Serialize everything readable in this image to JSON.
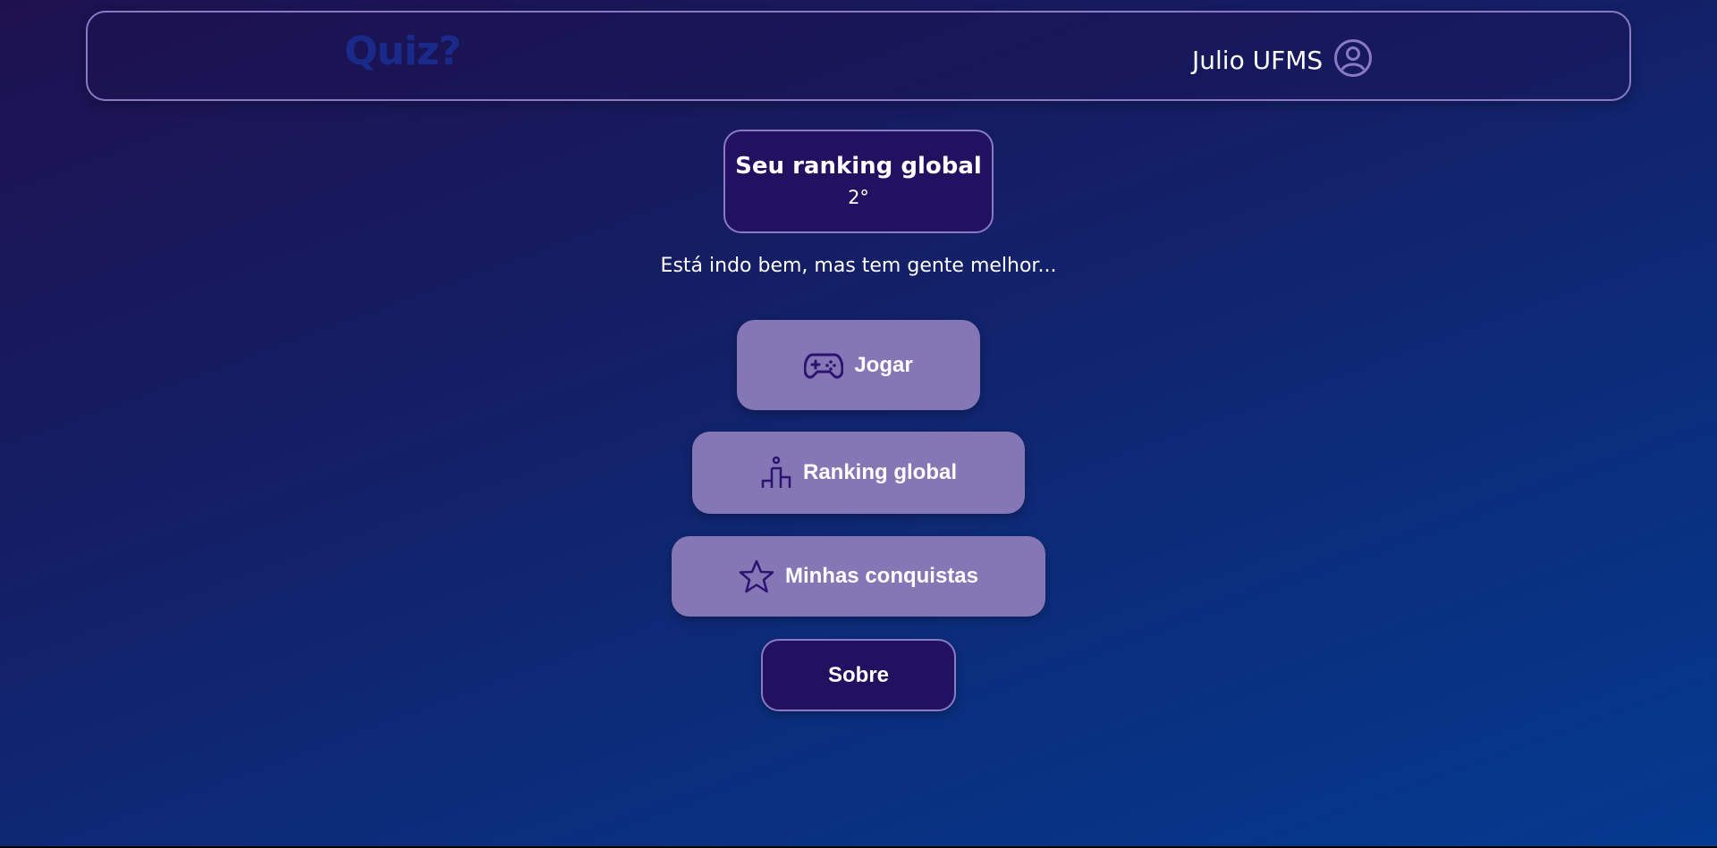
{
  "header": {
    "logo": "Quiz?",
    "user_name": "Julio UFMS",
    "avatar_icon": "user-circle-icon"
  },
  "ranking": {
    "title": "Seu ranking global",
    "value": "2°"
  },
  "message": "Está indo bem, mas tem gente melhor...",
  "menu": {
    "play": {
      "label": "Jogar",
      "icon": "gamepad-icon"
    },
    "ranking": {
      "label": "Ranking global",
      "icon": "podium-icon"
    },
    "achievements": {
      "label": "Minhas conquistas",
      "icon": "star-icon"
    },
    "about": {
      "label": "Sobre"
    }
  },
  "colors": {
    "button_bg": "#8576b6",
    "dark_card_bg": "#221060",
    "border": "#8a79c4",
    "icon": "#2a1470",
    "logo": "#1a2a8a"
  }
}
